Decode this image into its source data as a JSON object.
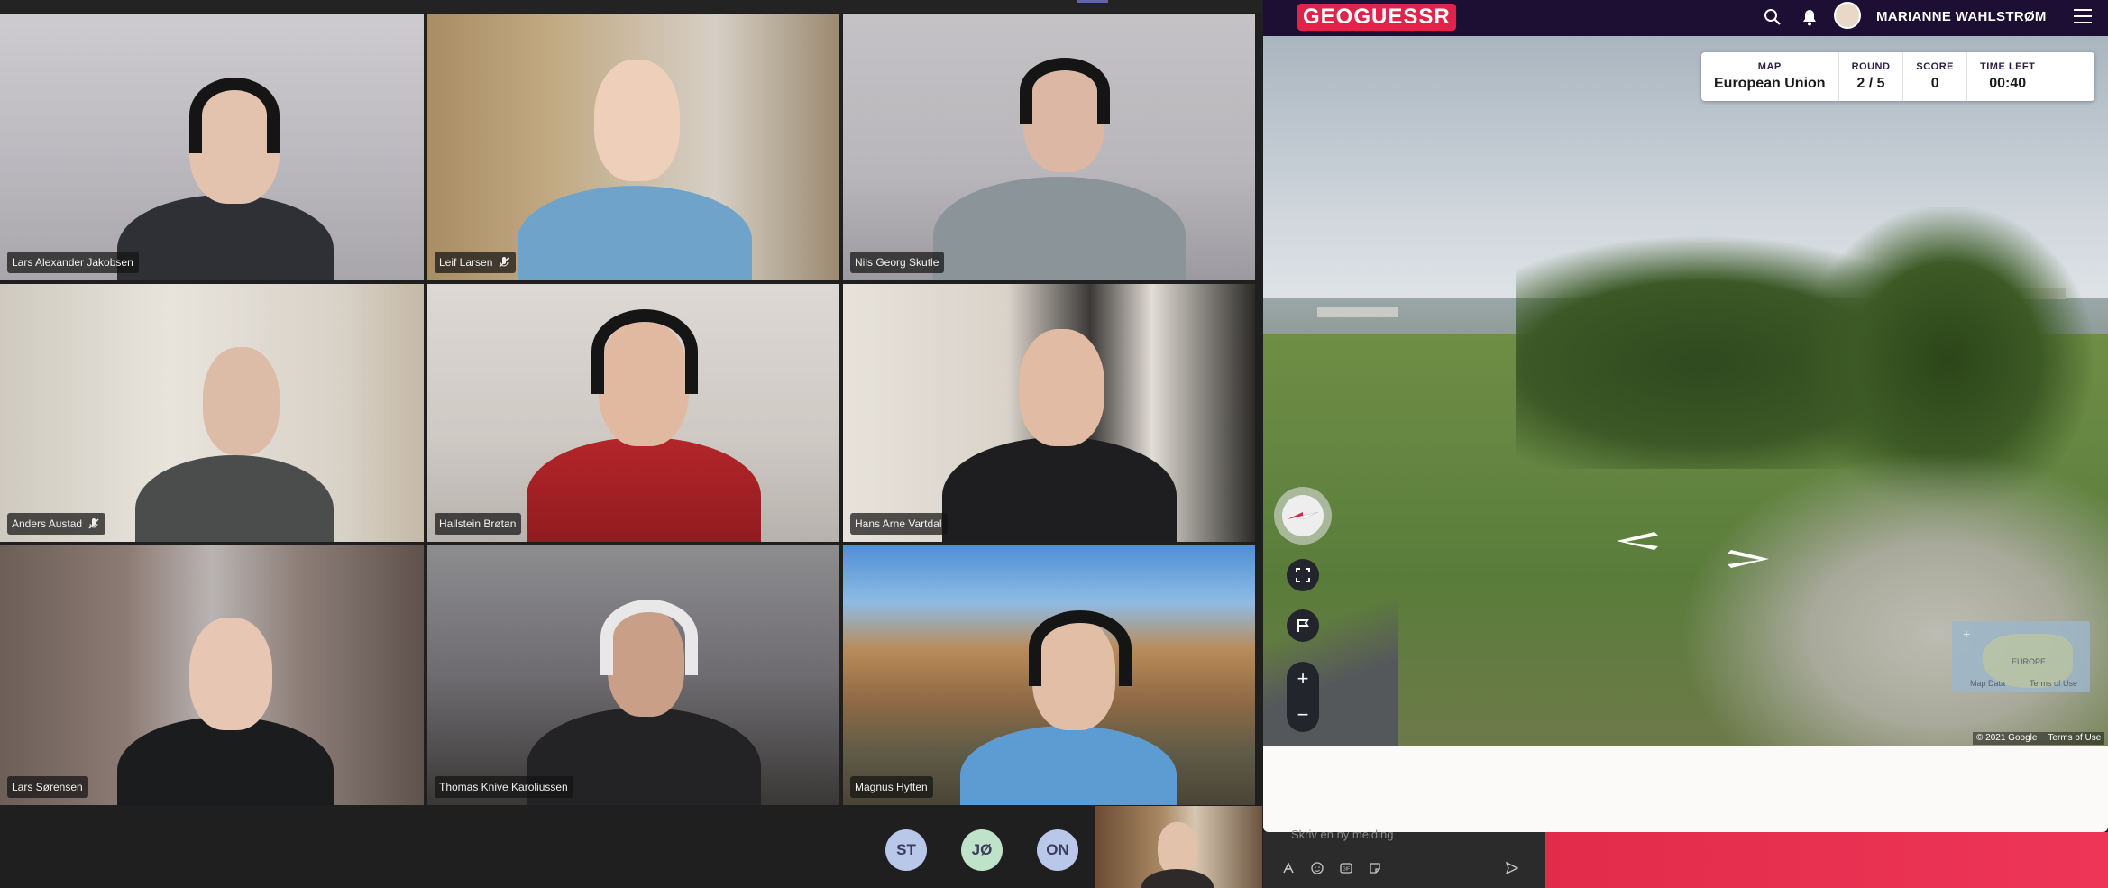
{
  "meeting": {
    "participants": [
      {
        "name": "Lars Alexander Jakobsen",
        "muted": false
      },
      {
        "name": "Leif Larsen",
        "muted": true
      },
      {
        "name": "Nils Georg Skutle",
        "muted": false
      },
      {
        "name": "Anders Austad",
        "muted": true
      },
      {
        "name": "Hallstein Brøtan",
        "muted": false
      },
      {
        "name": "Hans Arne Vartdal",
        "muted": false
      },
      {
        "name": "Lars Sørensen",
        "muted": false
      },
      {
        "name": "Thomas Knive Karoliussen",
        "muted": false
      },
      {
        "name": "Magnus Hytten",
        "muted": false
      }
    ],
    "avatars": [
      {
        "initials": "ST",
        "color": "#b9c7e8"
      },
      {
        "initials": "JØ",
        "color": "#bfe3c9"
      },
      {
        "initials": "ON",
        "color": "#b9c7e8"
      }
    ],
    "chat": {
      "placeholder": "Skriv en ny melding"
    }
  },
  "geoguessr": {
    "logo": "GEOGUESSR",
    "username": "MARIANNE WAHLSTRØM",
    "hud": {
      "map_label": "MAP",
      "map_value": "European Union",
      "round_label": "ROUND",
      "round_value": "2 / 5",
      "score_label": "SCORE",
      "score_value": "0",
      "time_label": "TIME LEFT",
      "time_value": "00:40"
    },
    "minimap": {
      "region": "EUROPE",
      "map_data": "Map Data",
      "terms": "Terms of Use"
    },
    "attribution": {
      "copyright": "© 2021 Google",
      "terms": "Terms of Use"
    },
    "brand_color": "#e0234a"
  }
}
